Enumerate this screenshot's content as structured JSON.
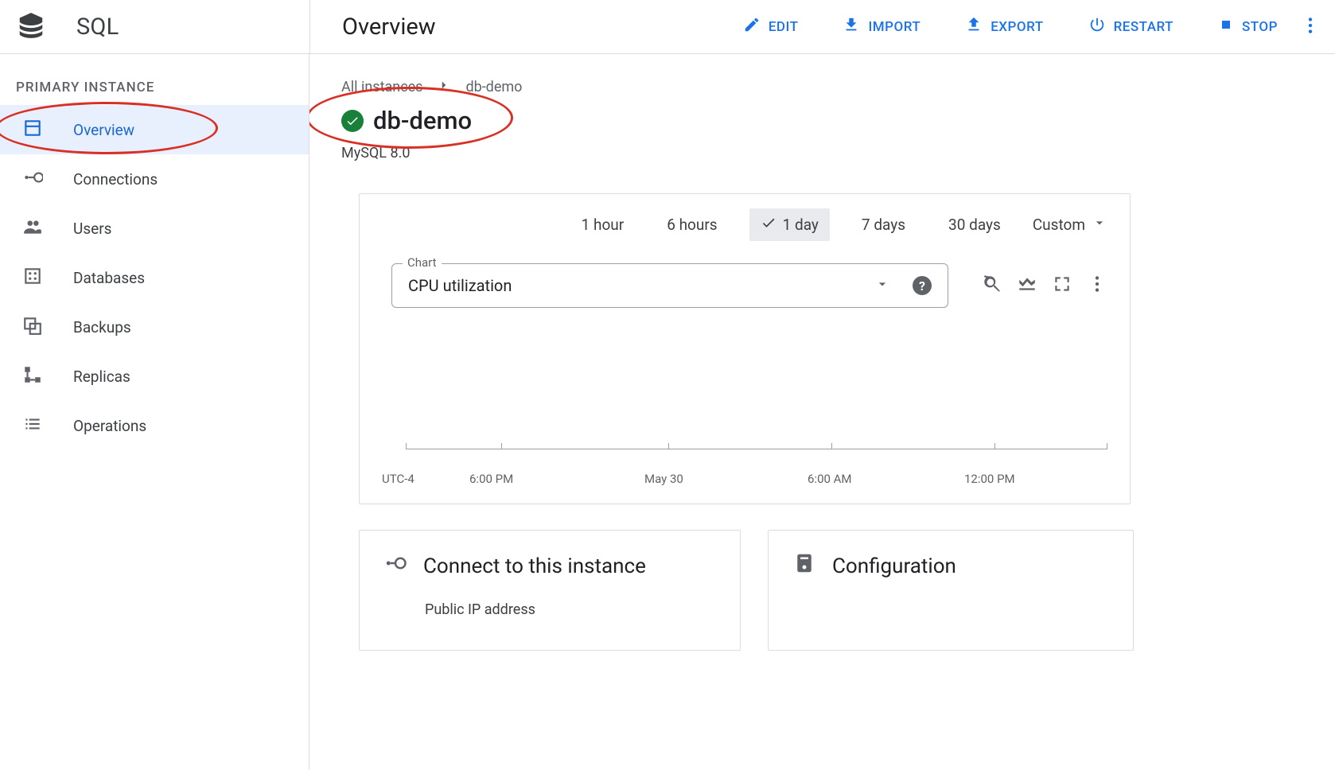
{
  "product": "SQL",
  "page_title": "Overview",
  "actions": {
    "edit": "EDIT",
    "import": "IMPORT",
    "export": "EXPORT",
    "restart": "RESTART",
    "stop": "STOP"
  },
  "sidebar": {
    "caption": "PRIMARY INSTANCE",
    "items": [
      {
        "label": "Overview"
      },
      {
        "label": "Connections"
      },
      {
        "label": "Users"
      },
      {
        "label": "Databases"
      },
      {
        "label": "Backups"
      },
      {
        "label": "Replicas"
      },
      {
        "label": "Operations"
      }
    ]
  },
  "breadcrumb": {
    "root": "All instances",
    "current": "db-demo"
  },
  "instance": {
    "name": "db-demo",
    "version": "MySQL 8.0"
  },
  "chart": {
    "select_label": "Chart",
    "metric": "CPU utilization",
    "ranges": {
      "h1": "1 hour",
      "h6": "6 hours",
      "d1": "1 day",
      "d7": "7 days",
      "d30": "30 days",
      "custom": "Custom"
    },
    "ticks": {
      "t0": "UTC-4",
      "t1": "6:00 PM",
      "t2": "May 30",
      "t3": "6:00 AM",
      "t4": "12:00 PM"
    }
  },
  "cards": {
    "connect": {
      "title": "Connect to this instance",
      "field1": "Public IP address"
    },
    "config": {
      "title": "Configuration"
    }
  }
}
